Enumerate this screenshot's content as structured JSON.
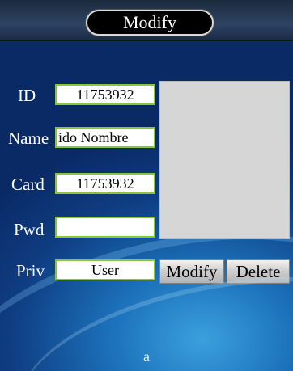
{
  "header": {
    "title": "Modify"
  },
  "form": {
    "id_label": "ID",
    "id_value": "11753932",
    "name_label": "Name",
    "name_value": "ido Nombre",
    "card_label": "Card",
    "card_value": "11753932",
    "pwd_label": "Pwd",
    "pwd_value": "",
    "priv_label": "Priv",
    "priv_value": "User"
  },
  "buttons": {
    "modify_label": "Modify",
    "delete_label": "Delete"
  },
  "footer": {
    "text": "a"
  },
  "colors": {
    "field_border": "#86c83a",
    "background": "#0f3d82",
    "photo_box": "#d6d6d6"
  }
}
